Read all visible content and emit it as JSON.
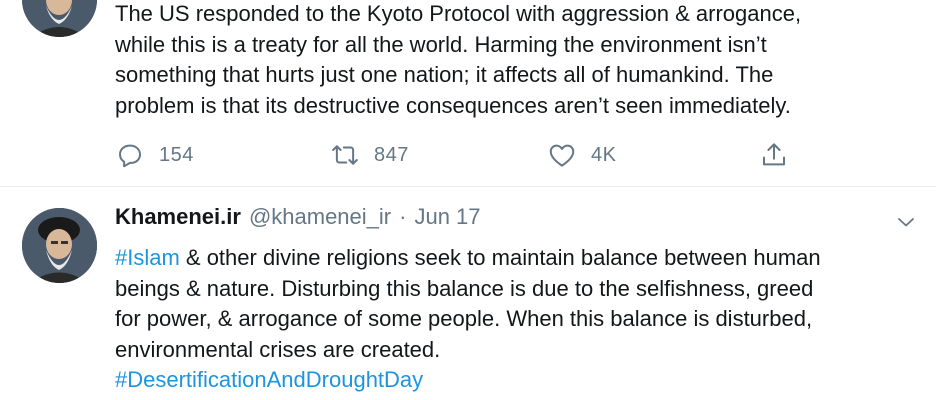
{
  "tweets": [
    {
      "text_lines": [
        "The US responded to the Kyoto Protocol with aggression & arrogance,",
        "while this is a treaty for all the world. Harming the environment isn’t",
        "something that hurts just one nation; it affects all of humankind. The",
        "problem is that its destructive consequences aren’t seen immediately."
      ],
      "actions": {
        "reply_count": "154",
        "retweet_count": "847",
        "like_count": "4K"
      },
      "icons": [
        "reply-icon",
        "retweet-icon",
        "like-icon",
        "share-icon"
      ]
    },
    {
      "author_name": "Khamenei.ir",
      "handle": "@khamenei_ir",
      "separator": "·",
      "date": "Jun 17",
      "hashtag_1": "#Islam",
      "line1_rest": " & other divine religions seek to maintain balance between human",
      "line2": "beings & nature. Disturbing this balance is due to the selfishness, greed",
      "line3": "for power, & arrogance of some people. When this balance is disturbed,",
      "line4": "environmental crises are created.",
      "hashtag_2": "#DesertificationAndDroughtDay",
      "icons": [
        "chevron-down-icon"
      ]
    }
  ],
  "colors": {
    "text": "#14171a",
    "secondary": "#657786",
    "link": "#1b95e0",
    "divider": "#e6ecf0"
  }
}
